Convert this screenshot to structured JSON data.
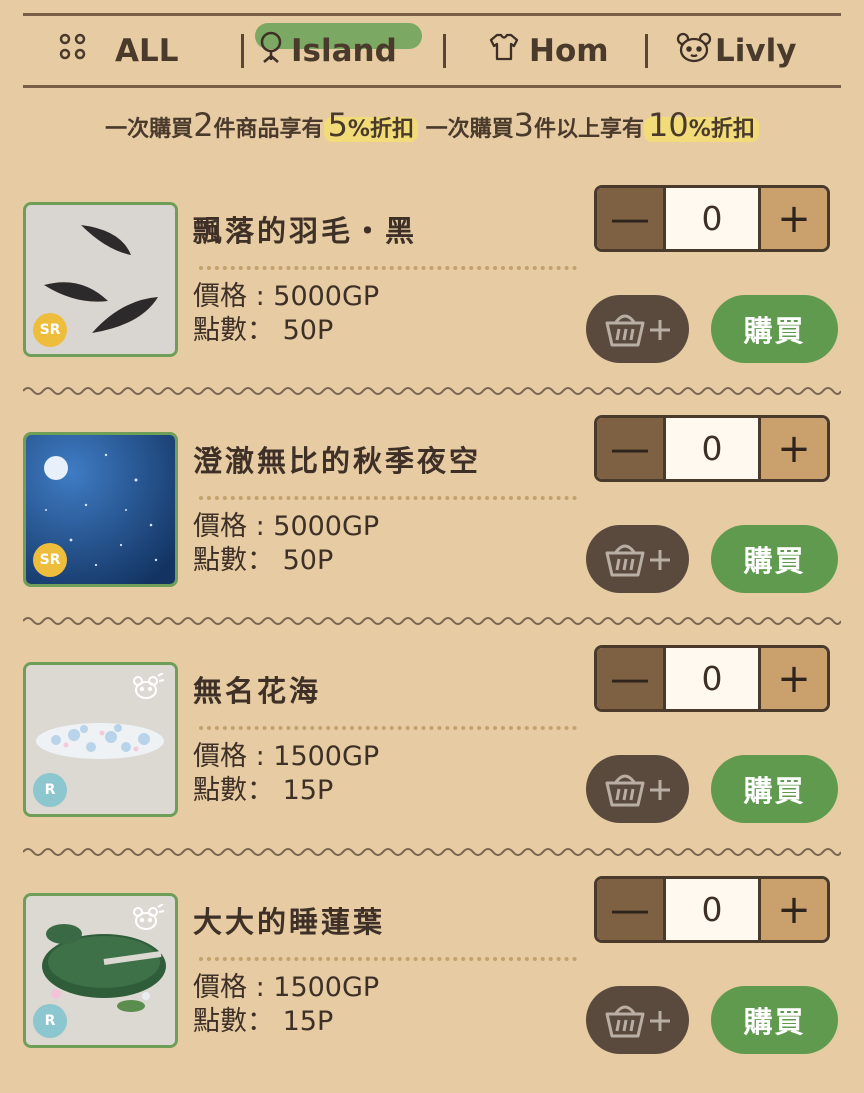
{
  "tabs": [
    {
      "label": "ALL",
      "icon": "grid-dots-icon"
    },
    {
      "label": "Island",
      "icon": "tree-icon"
    },
    {
      "label": "Hom",
      "icon": "shirt-icon"
    },
    {
      "label": "Livly",
      "icon": "livly-face-icon"
    }
  ],
  "active_tab": "Island",
  "promo": {
    "p1": "一次購買",
    "n1": "2",
    "p2": "件商品享有",
    "d1": "5",
    "pct1": "%",
    "p3": "折扣",
    "p4": "一次購買",
    "n2": "3",
    "p5": "件以上享有",
    "d2": "10",
    "pct2": "%",
    "p6": "折扣"
  },
  "items": [
    {
      "name": "飄落的羽毛・黑",
      "price_line": "價格 : 5000GP",
      "points_line": "點數： 50P",
      "rarity": "SR",
      "quantity": "0",
      "buy_label": "購買",
      "livly_badge": false
    },
    {
      "name": "澄澈無比的秋季夜空",
      "price_line": "價格 : 5000GP",
      "points_line": "點數： 50P",
      "rarity": "SR",
      "quantity": "0",
      "buy_label": "購買",
      "livly_badge": false
    },
    {
      "name": "無名花海",
      "price_line": "價格 : 1500GP",
      "points_line": "點數： 15P",
      "rarity": "R",
      "quantity": "0",
      "buy_label": "購買",
      "livly_badge": true
    },
    {
      "name": "大大的睡蓮葉",
      "price_line": "價格 : 1500GP",
      "points_line": "點數： 15P",
      "rarity": "R",
      "quantity": "0",
      "buy_label": "購買",
      "livly_badge": true
    }
  ],
  "stepper": {
    "minus": "—",
    "plus": "+"
  },
  "colors": {
    "background": "#e6cba3",
    "buy_green": "#5f9a4f",
    "cart_dark": "#5a4a3e",
    "highlight_yellow": "#f2dc7a",
    "frame_green": "#6e9e58"
  }
}
